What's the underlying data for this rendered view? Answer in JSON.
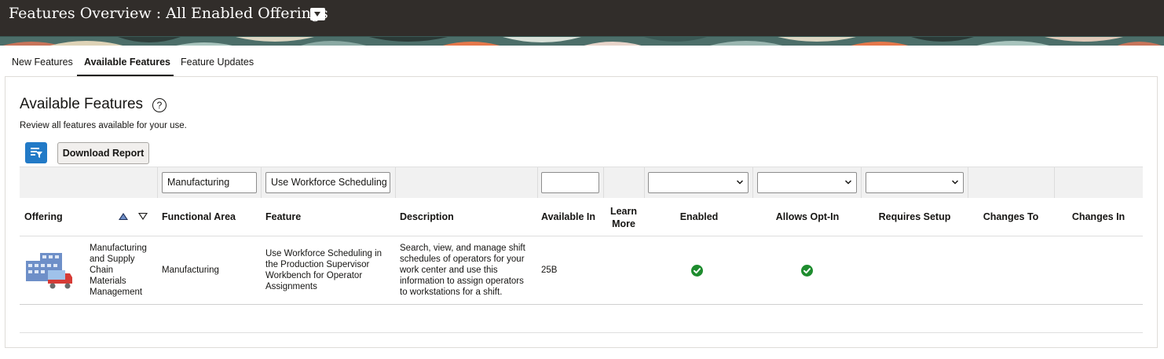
{
  "header": {
    "title": "Features Overview : All Enabled Offerings"
  },
  "tabs": [
    {
      "label": "New Features",
      "active": false
    },
    {
      "label": "Available Features",
      "active": true
    },
    {
      "label": "Feature Updates",
      "active": false
    }
  ],
  "section": {
    "title": "Available Features",
    "help_icon": "?",
    "description": "Review all features available for your use.",
    "download_label": "Download Report"
  },
  "filters": {
    "functional_area": "Manufacturing",
    "feature": "Use Workforce Scheduling",
    "available_in": "",
    "enabled": "",
    "allows_opt_in": "",
    "requires_setup": ""
  },
  "columns": {
    "offering": "Offering",
    "functional_area": "Functional Area",
    "feature": "Feature",
    "description": "Description",
    "available_in": "Available In",
    "learn_more_1": "Learn",
    "learn_more_2": "More",
    "enabled": "Enabled",
    "allows_opt_in": "Allows Opt-In",
    "requires_setup": "Requires Setup",
    "changes_to": "Changes To",
    "changes_in": "Changes In"
  },
  "rows": [
    {
      "icon": "manufacturing-building-truck-icon",
      "offering_lines": [
        "Manufacturing",
        "and Supply",
        "Chain",
        "Materials",
        "Management"
      ],
      "functional_area": "Manufacturing",
      "feature_lines": [
        "Use Workforce Scheduling in",
        "the Production Supervisor",
        "Workbench for Operator",
        "Assignments"
      ],
      "description_lines": [
        "Search, view, and manage shift",
        "schedules of operators for your",
        "work center and use this",
        "information to assign operators",
        "to workstations for a shift."
      ],
      "available_in": "25B",
      "enabled": true,
      "allows_opt_in": true,
      "requires_setup": false
    }
  ],
  "colors": {
    "topbar": "#312d2a",
    "accent_blue": "#227ac7",
    "check_green": "#1e8c2e"
  }
}
